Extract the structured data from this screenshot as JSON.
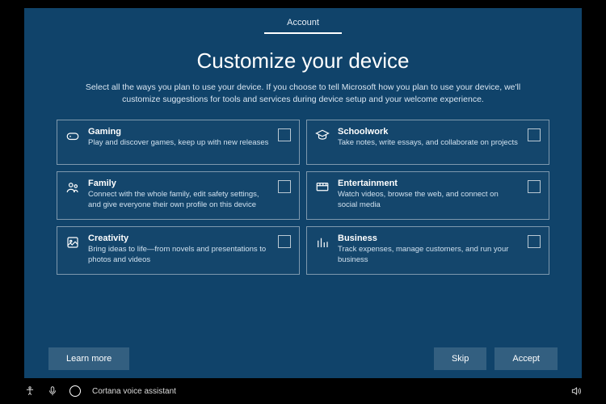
{
  "tab": {
    "label": "Account"
  },
  "heading": "Customize your device",
  "subtitle": "Select all the ways you plan to use your device. If you choose to tell Microsoft how you plan to use your device, we'll customize suggestions for tools and services during device setup and your welcome experience.",
  "cards": [
    {
      "title": "Gaming",
      "desc": "Play and discover games, keep up with new releases"
    },
    {
      "title": "Schoolwork",
      "desc": "Take notes, write essays, and collaborate on projects"
    },
    {
      "title": "Family",
      "desc": "Connect with the whole family, edit safety settings, and give everyone their own profile on this device"
    },
    {
      "title": "Entertainment",
      "desc": "Watch videos, browse the web, and connect on social media"
    },
    {
      "title": "Creativity",
      "desc": "Bring ideas to life—from novels and presentations to photos and videos"
    },
    {
      "title": "Business",
      "desc": "Track expenses, manage customers, and run your business"
    }
  ],
  "buttons": {
    "learn_more": "Learn more",
    "skip": "Skip",
    "accept": "Accept"
  },
  "taskbar": {
    "cortana": "Cortana voice assistant"
  }
}
